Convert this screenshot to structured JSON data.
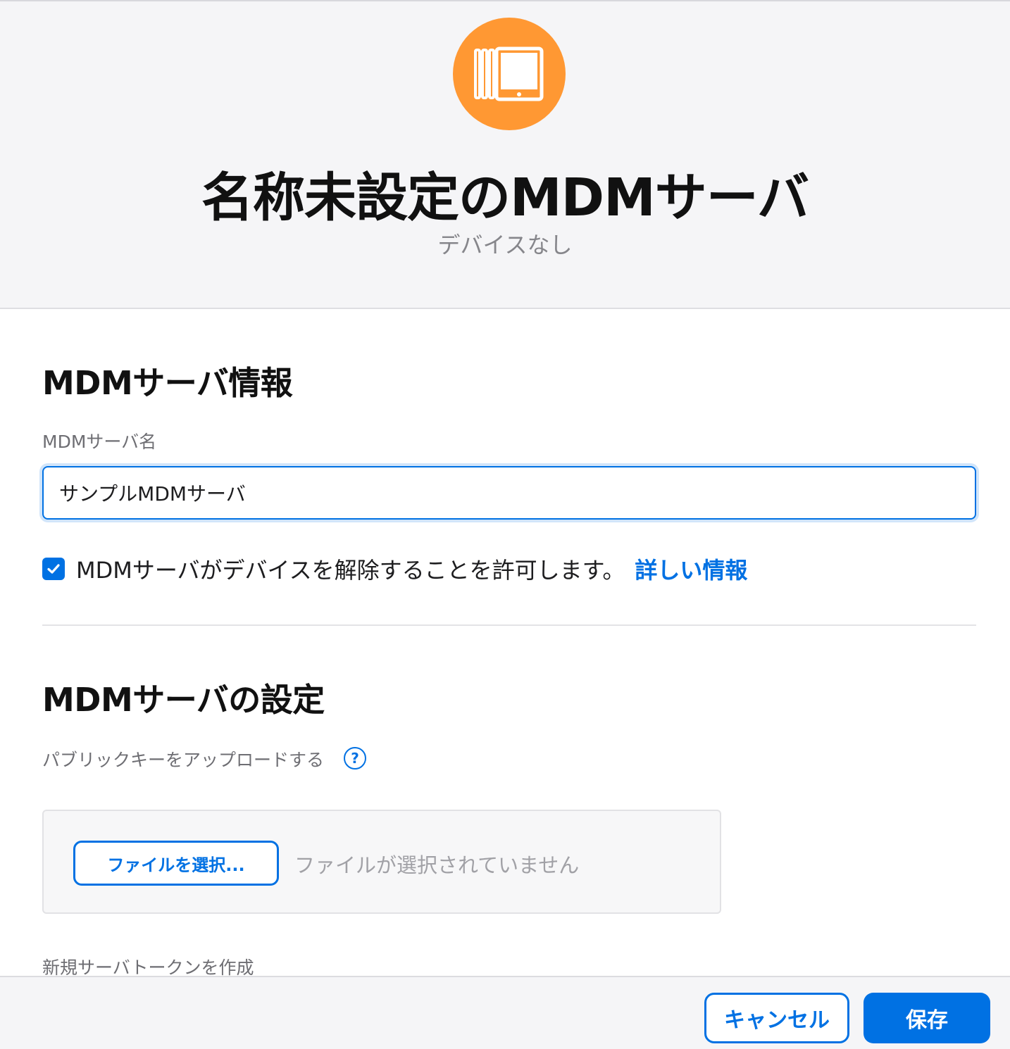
{
  "header": {
    "icon": "devices-stack-icon",
    "icon_color": "#ff9833",
    "title": "名称未設定のMDMサーバ",
    "subtitle": "デバイスなし"
  },
  "server_info": {
    "section_title": "MDMサーバ情報",
    "name_label": "MDMサーバ名",
    "name_value": "サンプルMDMサーバ",
    "release_checkbox_checked": true,
    "release_checkbox_label": "MDMサーバがデバイスを解除することを許可します。",
    "learn_more_link": "詳しい情報"
  },
  "server_settings": {
    "section_title": "MDMサーバの設定",
    "public_key_label": "パブリックキーをアップロードする",
    "help_icon": "?",
    "choose_file_button": "ファイルを選択...",
    "no_file_text": "ファイルが選択されていません",
    "new_token_label": "新規サーバトークンを作成"
  },
  "footer": {
    "cancel_label": "キャンセル",
    "save_label": "保存"
  },
  "colors": {
    "accent": "#0071e3",
    "header_bg": "#f5f5f7"
  }
}
